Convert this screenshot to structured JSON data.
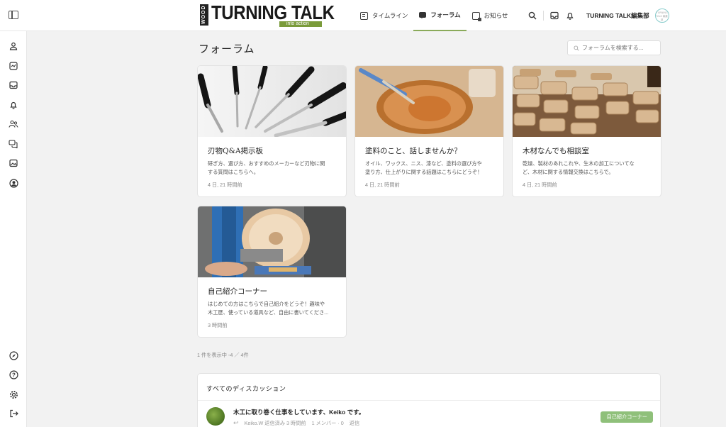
{
  "header": {
    "logo_vertical": "WOOD",
    "logo_main": "TURNING TALK",
    "logo_tagline": "into action",
    "nav": [
      {
        "label": "タイムライン",
        "icon": "timeline-icon"
      },
      {
        "label": "フォーラム",
        "icon": "forum-icon",
        "active": true
      },
      {
        "label": "お知らせ",
        "icon": "news-icon"
      }
    ],
    "user_name": "TURNING TALK編集部",
    "avatar_text": "TURNING TALK 編集部"
  },
  "sidebar": {
    "items": [
      "profile-icon",
      "activity-icon",
      "inbox-icon",
      "notifications-icon",
      "members-icon",
      "forums-icon",
      "photos-icon",
      "account-icon",
      "compass-icon",
      "help-icon",
      "settings-icon",
      "logout-icon"
    ]
  },
  "main": {
    "title": "フォーラム",
    "search_placeholder": "フォーラムを検索する...",
    "cards": [
      {
        "title": "刃物Q&A掲示板",
        "desc": "研ぎ方、選び方、おすすめのメーカーなど刃物に関\nする質問はこちらへ。",
        "time": "4 日, 21 時間前",
        "image": "tools"
      },
      {
        "title": "塗料のこと、話しませんか？",
        "desc": "オイル、ワックス、ニス、漆など、塗料の選び方や\n塗り方、仕上がりに関する話題はこちらにどうぞ！",
        "time": "4 日, 21 時間前",
        "image": "plate"
      },
      {
        "title": "木材なんでも相談室",
        "desc": "乾燥、製材のあれこれや、生木の加工についてな\nど、木材に関する情報交換はこちらで。",
        "time": "4 日, 21 時間前",
        "image": "wood"
      },
      {
        "title": "自己紹介コーナー",
        "desc": "はじめての方はこちらで自己紹介をどうぞ！趣味や\n木工歴、使っている道具など、自由に書いてくださ...",
        "time": "3 時間前",
        "image": "lathe"
      }
    ],
    "count_text": "1 件を表示中 -4 ／ 4件",
    "discussions": {
      "heading": "すべてのディスカッション",
      "rows": [
        {
          "title": "木工に取り巻く仕事をしています、Keiko です。",
          "meta_user": "Keiko.W 返信済み 3 時間前",
          "members": "1 メンバー · 0",
          "replies": "返信",
          "badge": "自己紹介コーナー"
        }
      ]
    }
  },
  "colors": {
    "accent": "#8aaa5a",
    "badge": "#8fc07a",
    "logo_tag": "#7a9b3a"
  }
}
